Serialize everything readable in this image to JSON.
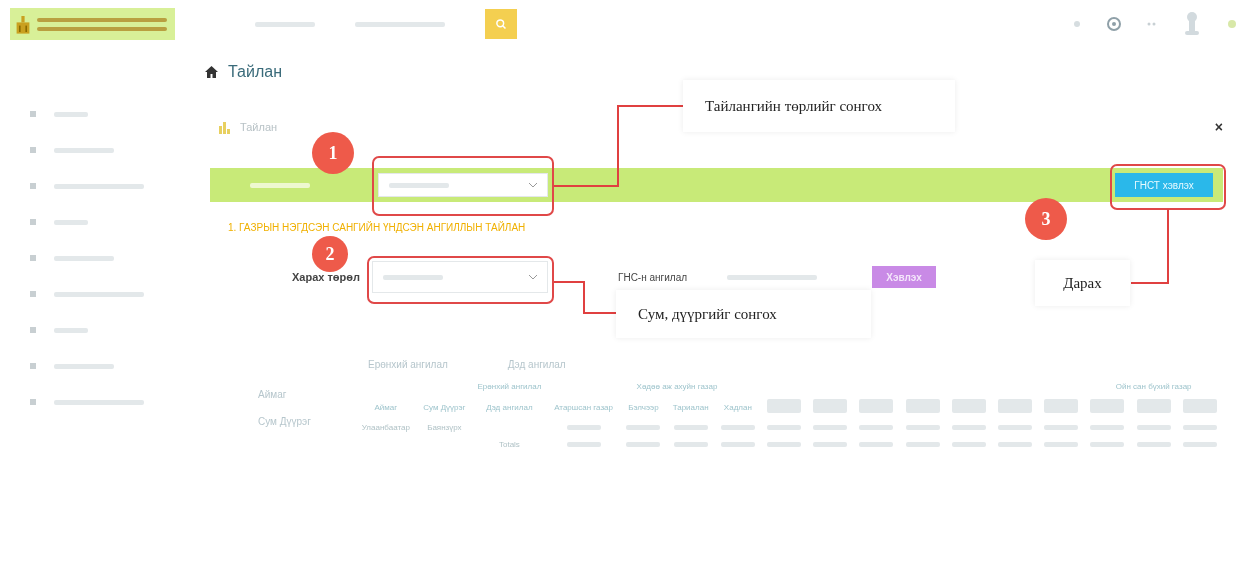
{
  "breadcrumb": {
    "title": "Тайлан"
  },
  "panel": {
    "title": "Тайлан",
    "close": "×"
  },
  "report_bar": {
    "print_button": "ГНСТ хэвлэх"
  },
  "report_title": "1. ГАЗРЫН НЭГДСЭН САНГИЙН ҮНДСЭН АНГИЛЛЫН ТАЙЛАН",
  "filters": {
    "view_label": "Харах төрөл",
    "class_label": "ГНС-н ангилал",
    "print_button": "Хэвлэх"
  },
  "pivot": {
    "row_fields": [
      "Аймаг",
      "Сум Дүүрэг"
    ],
    "col_fields": [
      "Ерөнхий ангилал",
      "Дэд ангилал"
    ]
  },
  "table": {
    "group_headers": [
      "Хөдөө аж ахуйн газар",
      "Ойн сан бүхий газар"
    ],
    "row_headers": [
      "Аймаг",
      "Сум Дүүрэг"
    ],
    "column_field_headers": [
      "Ерөнхий ангилал",
      "Дэд ангилал"
    ],
    "columns": [
      "Атаршсан газар",
      "Бэлчээр",
      "Тариалан",
      "Хадлан"
    ],
    "rows": [
      {
        "aimag": "Улаанбаатар",
        "district": "Баянзүрх"
      }
    ],
    "totals_label": "Totals"
  },
  "annotations": [
    {
      "number": "1",
      "text": "Тайлангийн төрлийг сонгох"
    },
    {
      "number": "2",
      "text": "Сум, дүүргийг сонгох"
    },
    {
      "number": "3",
      "text": "Дарах"
    }
  ]
}
